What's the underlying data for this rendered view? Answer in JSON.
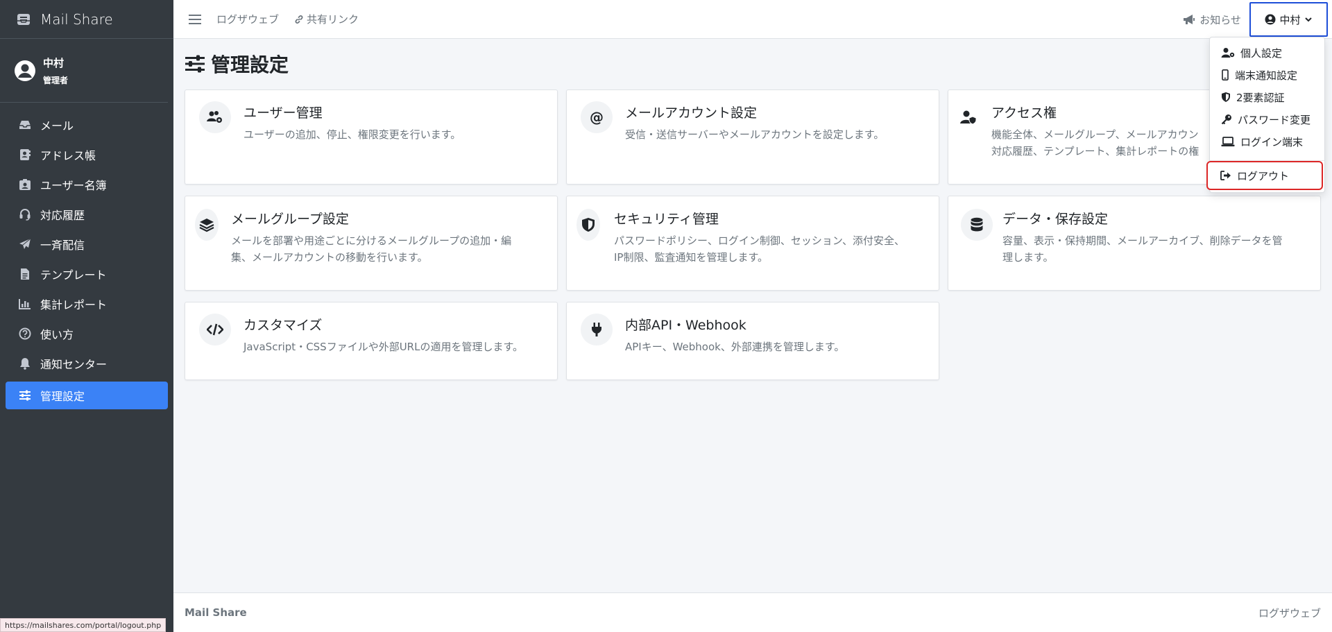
{
  "app": {
    "brand": "Mail Share"
  },
  "user_panel": {
    "name": "中村",
    "role": "管理者"
  },
  "sidebar": {
    "items": [
      {
        "label": "メール",
        "icon": "inbox-icon"
      },
      {
        "label": "アドレス帳",
        "icon": "address-book-icon"
      },
      {
        "label": "ユーザー名簿",
        "icon": "id-badge-icon"
      },
      {
        "label": "対応履歴",
        "icon": "headset-icon"
      },
      {
        "label": "一斉配信",
        "icon": "paper-plane-icon"
      },
      {
        "label": "テンプレート",
        "icon": "file-icon"
      },
      {
        "label": "集計レポート",
        "icon": "bar-chart-icon"
      },
      {
        "label": "使い方",
        "icon": "question-circle-icon"
      },
      {
        "label": "通知センター",
        "icon": "bell-icon"
      },
      {
        "label": "管理設定",
        "icon": "sliders-icon",
        "active": true
      }
    ]
  },
  "topbar": {
    "links": [
      {
        "label": "ログザウェブ"
      },
      {
        "label": "共有リンク"
      }
    ],
    "notice": "お知らせ",
    "user": "中村"
  },
  "page": {
    "title": "管理設定",
    "cards": [
      {
        "title": "ユーザー管理",
        "desc": "ユーザーの追加、停止、権限変更を行います。",
        "icon": "users-gear-icon"
      },
      {
        "title": "メールアカウント設定",
        "desc": "受信・送信サーバーやメールアカウントを設定します。",
        "icon": "at-sign-icon"
      },
      {
        "title": "アクセス権",
        "desc": "機能全体、メールグループ、メールアカウン\n対応履歴、テンプレート、集計レポートの権",
        "icon": "user-shield-icon"
      },
      {
        "title": "メールグループ設定",
        "desc": "メールを部署や用途ごとに分けるメールグループの追加・編\n集、メールアカウントの移動を行います。",
        "icon": "layers-icon"
      },
      {
        "title": "セキュリティ管理",
        "desc": "パスワードポリシー、ログイン制御、セッション、添付安全、\nIP制限、監査通知を管理します。",
        "icon": "shield-icon"
      },
      {
        "title": "データ・保存設定",
        "desc": "容量、表示・保持期間、メールアーカイブ、削除データを管\n理します。",
        "icon": "database-icon"
      },
      {
        "title": "カスタマイズ",
        "desc": "JavaScript・CSSファイルや外部URLの適用を管理します。",
        "icon": "code-icon"
      },
      {
        "title": "内部API・Webhook",
        "desc": "APIキー、Webhook、外部連携を管理します。",
        "icon": "plug-icon"
      }
    ]
  },
  "dropdown": {
    "items": [
      {
        "label": "個人設定",
        "icon": "user-gear-icon"
      },
      {
        "label": "端末通知設定",
        "icon": "mobile-icon"
      },
      {
        "label": "2要素認証",
        "icon": "shield-half-icon"
      },
      {
        "label": "パスワード変更",
        "icon": "key-icon"
      },
      {
        "label": "ログイン端末",
        "icon": "laptop-icon"
      }
    ],
    "logout": "ログアウト"
  },
  "footer": {
    "brand": "Mail Share",
    "link": "ログザウェブ"
  },
  "statusbar": {
    "url": "https://mailshares.com/portal/logout.php"
  },
  "colors": {
    "sidebar_bg": "#343a40",
    "active": "#3b82f6",
    "highlight": "#dc2626",
    "focus": "#1d4ed8"
  }
}
